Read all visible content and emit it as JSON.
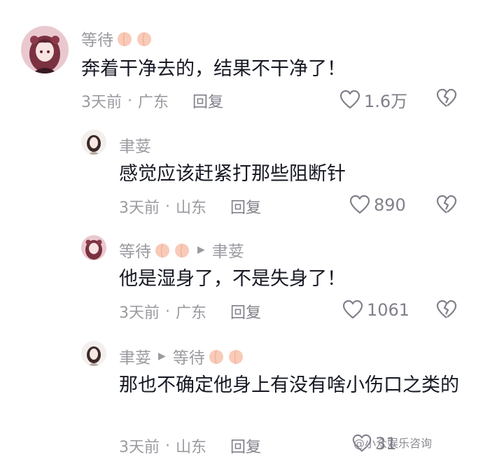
{
  "comments": [
    {
      "author": "等待",
      "reply_to": "",
      "text": "奔着干净去的，结果不干净了！",
      "time": "3天前",
      "location": "广东",
      "reply_label": "回复",
      "likes": "1.6万"
    },
    {
      "author": "聿荽",
      "reply_to": "",
      "text": "感觉应该赶紧打那些阻断针",
      "time": "3天前",
      "location": "山东",
      "reply_label": "回复",
      "likes": "890"
    },
    {
      "author": "等待",
      "reply_to": "聿荽",
      "text": "他是湿身了，不是失身了！",
      "time": "3天前",
      "location": "广东",
      "reply_label": "回复",
      "likes": "1061"
    },
    {
      "author": "聿荽",
      "reply_to": "等待",
      "text": "那也不确定他身上有没有啥小伤口之类的",
      "time": "3天前",
      "location": "山东",
      "reply_label": "回复",
      "likes": "31"
    }
  ],
  "watermark": "@小众娱乐咨询",
  "colors": {
    "meta": "#9a9aa0",
    "text": "#161823",
    "peach": "#f6c2b0"
  },
  "icons": [
    "heart-icon",
    "broken-heart-icon",
    "peach-emoji-icon",
    "reply-arrow-icon"
  ]
}
